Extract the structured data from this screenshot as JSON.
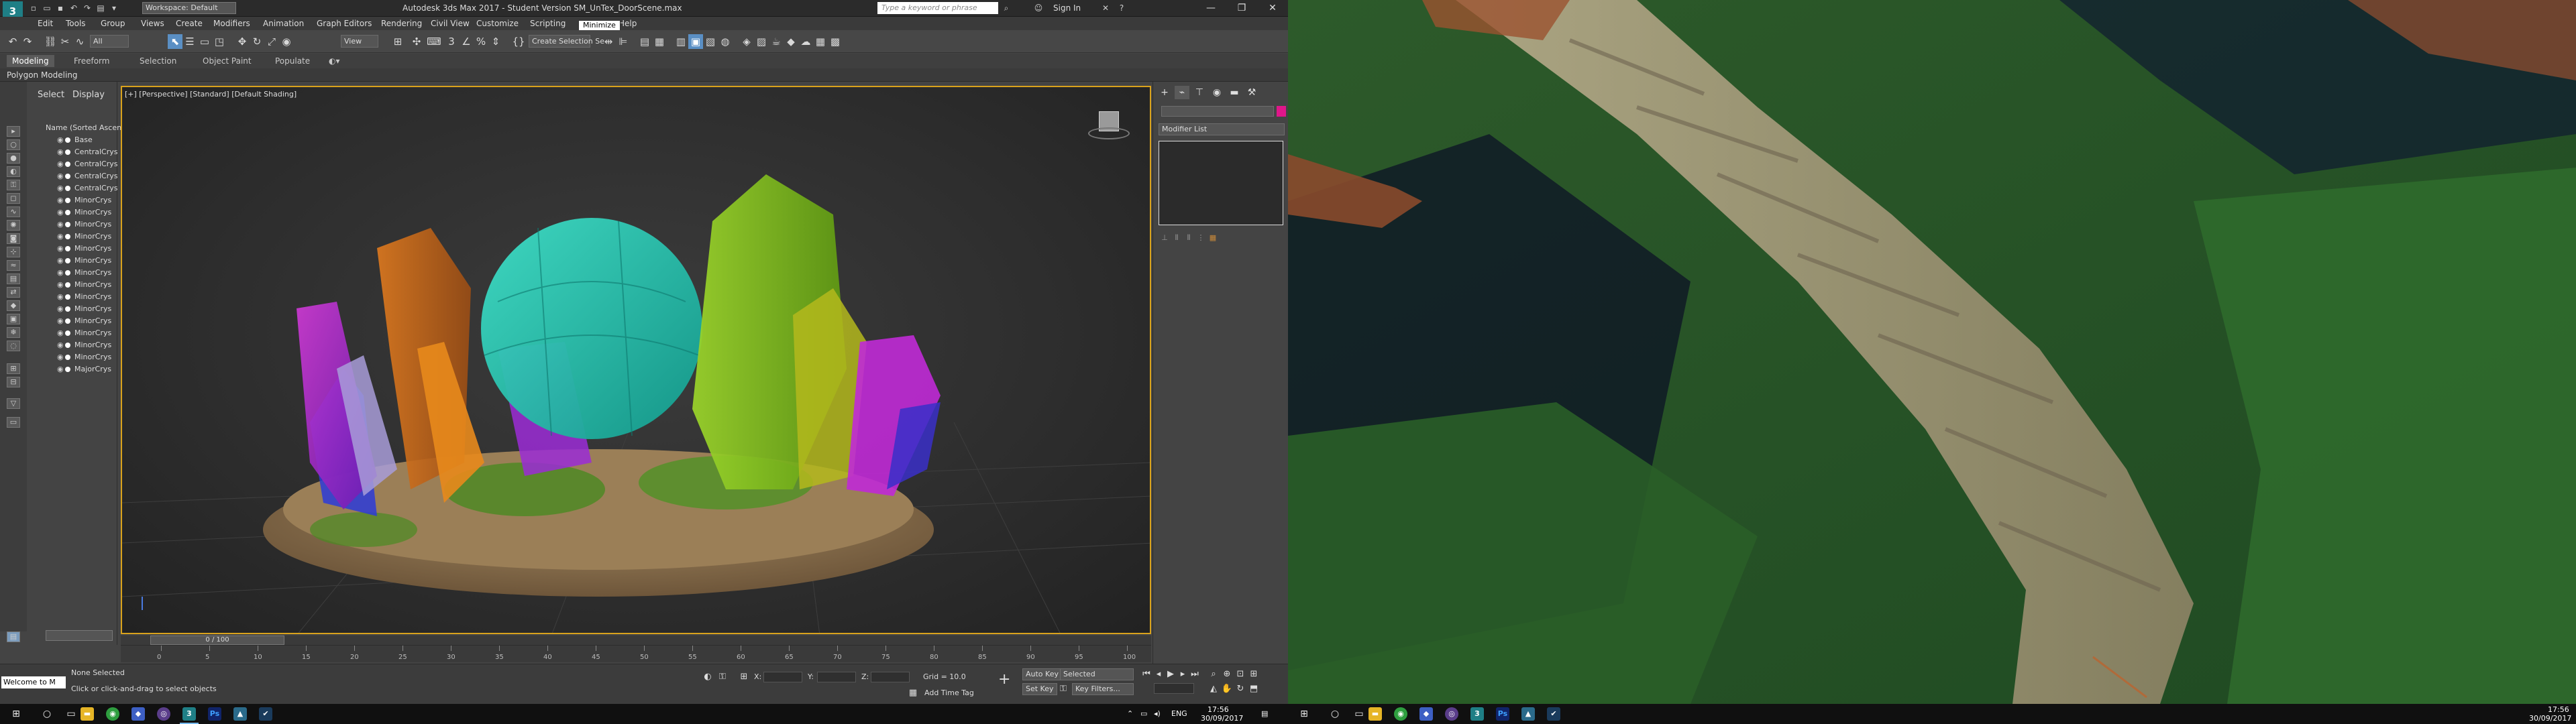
{
  "titlebar": {
    "logo": "3",
    "workspace": "Workspace: Default",
    "title": "Autodesk 3ds Max 2017 - Student Version    SM_UnTex_DoorScene.max",
    "search_placeholder": "Type a keyword or phrase",
    "sign_in": "Sign In",
    "controls": [
      "—",
      "❐",
      "✕"
    ]
  },
  "menu": {
    "items": [
      "Edit",
      "Tools",
      "Group",
      "Views",
      "Create",
      "Modifiers",
      "Animation",
      "Graph Editors",
      "Rendering",
      "Civil View",
      "Customize",
      "Scripting",
      "Minimize",
      "Help"
    ],
    "tooltip": "Minimize"
  },
  "toolbar": {
    "filter": "All",
    "view": "View",
    "selection_set": "Create Selection Se"
  },
  "ribbon": {
    "tabs": [
      "Modeling",
      "Freeform",
      "Selection",
      "Object Paint",
      "Populate"
    ],
    "sub_label": "Polygon Modeling"
  },
  "explorer": {
    "tabs": [
      "Select",
      "Display"
    ],
    "header": "Name (Sorted Ascen",
    "rows": [
      "Base",
      "CentralCrys",
      "CentralCrys",
      "CentralCrys",
      "CentralCrys",
      "MinorCrys",
      "MinorCrys",
      "MinorCrys",
      "MinorCrys",
      "MinorCrys",
      "MinorCrys",
      "MinorCrys",
      "MinorCrys",
      "MinorCrys",
      "MinorCrys",
      "MinorCrys",
      "MinorCrys",
      "MinorCrys",
      "MinorCrys",
      "MajorCrys"
    ]
  },
  "viewport": {
    "label": "[+] [Perspective] [Standard] [Default Shading]"
  },
  "timeline": {
    "frame": "0 / 100",
    "ticks": [
      "0",
      "5",
      "10",
      "15",
      "20",
      "25",
      "30",
      "35",
      "40",
      "45",
      "50",
      "55",
      "60",
      "65",
      "70",
      "75",
      "80",
      "85",
      "90",
      "95",
      "100"
    ]
  },
  "status": {
    "maxscript": "Welcome to M",
    "selection": "None Selected",
    "prompt": "Click or click-and-drag to select objects",
    "x_label": "X:",
    "y_label": "Y:",
    "z_label": "Z:",
    "grid": "Grid = 10.0",
    "add_time_tag": "Add Time Tag",
    "auto_key": "Auto Key",
    "selected": "Selected",
    "set_key": "Set Key",
    "key_filters": "Key Filters..."
  },
  "cmdpanel": {
    "modifier_list": "Modifier List",
    "color": "#e0168a"
  },
  "taskbar_left": {
    "lang": "ENG",
    "time": "17:56",
    "date": "30/09/2017"
  },
  "taskbar_right": {
    "time": "17:56",
    "date": "30/09/2017"
  }
}
